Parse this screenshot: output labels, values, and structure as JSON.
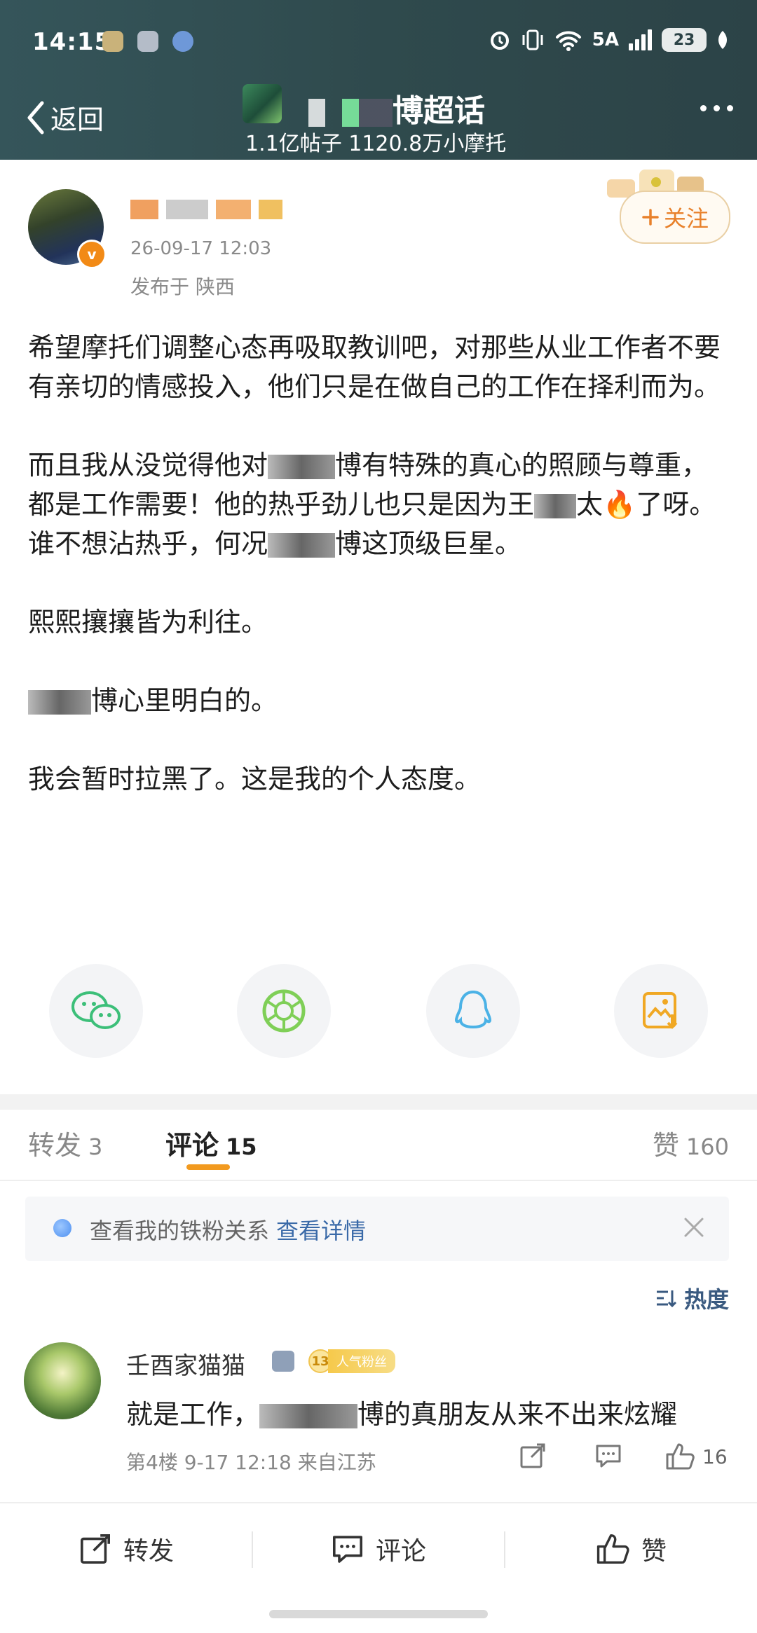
{
  "status_bar": {
    "time": "14:15",
    "network": "5A",
    "battery": "23"
  },
  "nav": {
    "back_label": "返回",
    "topic_title_suffix": "博超话",
    "topic_stats": "1.1亿帖子 1120.8万小摩托"
  },
  "post": {
    "time": "26-09-17 12:03",
    "location": "发布于 陕西",
    "follow_label": "关注",
    "paragraphs": {
      "p1": "希望摩托们调整心态再吸取教训吧，对那些从业工作者不要有亲切的情感投入，他们只是在做自己的工作在择利而为。",
      "p2a": "而且我从没觉得他对",
      "p2b": "博有特殊的真心的照顾与尊重，都是工作需要！他的热乎劲儿也只是因为王",
      "p2c": "太🔥了呀。谁不想沾热乎，何况",
      "p2d": "博这顶级巨星。",
      "p3": "熙熙攘攘皆为利往。",
      "p4": "博心里明白的。",
      "p5": "我会暂时拉黑了。这是我的个人态度。"
    }
  },
  "tabs": {
    "repost_label": "转发",
    "repost_count": "3",
    "comment_label": "评论",
    "comment_count": "15",
    "like_label": "赞",
    "like_count": "160"
  },
  "fans_banner": {
    "text": "查看我的铁粉关系",
    "link": "查看详情"
  },
  "sort": {
    "label": "热度"
  },
  "comment": {
    "name": "壬酉家猫猫",
    "fan_level": "13",
    "fan_badge": "人气粉丝",
    "text_a": "就是工作，",
    "text_b": "博的真朋友从来不出来炫耀",
    "meta": "第4楼 9-17 12:18 来自江苏",
    "likes": "16"
  },
  "toolbar": {
    "repost": "转发",
    "comment": "评论",
    "like": "赞"
  },
  "colors": {
    "header_bg": "#2f4a4d",
    "accent_orange": "#f29a1f",
    "link_blue": "#3a6aa8"
  }
}
